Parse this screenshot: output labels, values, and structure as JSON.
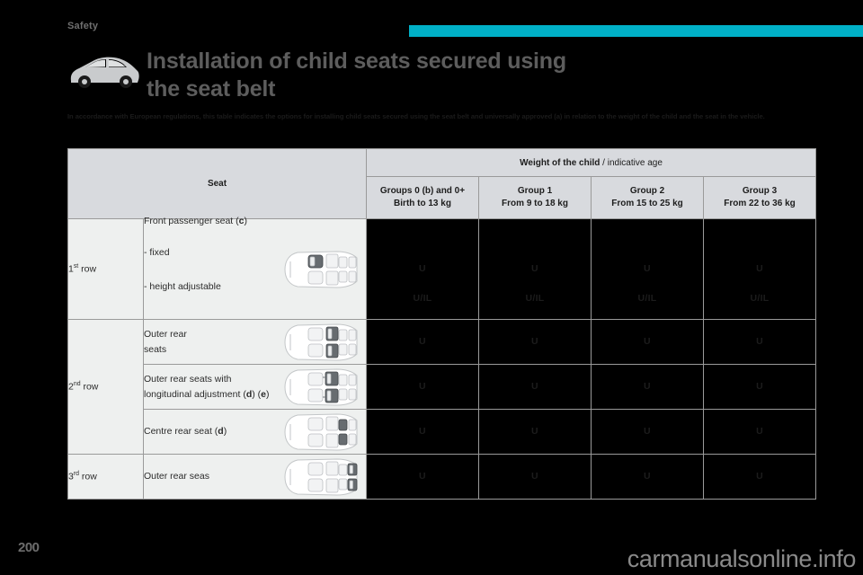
{
  "header": {
    "breadcrumb": "Safety",
    "accent_color": "#00b0c7"
  },
  "title": {
    "line1": "Installation of child seats secured using",
    "line2": "the seat belt",
    "icon": "car-side-view-icon"
  },
  "intro": {
    "line1": "In accordance with European regulations, this table indicates the options for installing child seats secured using the seat belt and universally approved (a)",
    "line2": "in relation to the weight of the child and the seat in the vehicle."
  },
  "table": {
    "seat_header": "Seat",
    "weight_header_bold": "Weight of the child",
    "weight_header_sep": " / ",
    "weight_header_light": "indicative age",
    "groups": [
      {
        "line1": "Groups 0 (b) and 0+",
        "line2": "Birth to 13 kg"
      },
      {
        "line1": "Group 1",
        "line2": "From 9 to 18 kg"
      },
      {
        "line1": "Group 2",
        "line2": "From 15 to 25 kg"
      },
      {
        "line1": "Group 3",
        "line2": "From 22 to 36 kg"
      }
    ],
    "rows": [
      {
        "row_label_num": "1",
        "row_label_sup": "st",
        "row_label_rest": " row",
        "seat_title": "Front passenger seat (",
        "seat_title_bold": "c",
        "seat_title_end": ")",
        "bullets": [
          "-     fixed",
          "-     height adjustable"
        ],
        "diagram": "seat-plan-front-passenger",
        "marks": [
          {
            "top": "U",
            "bottom": "U/IL"
          },
          {
            "top": "U",
            "bottom": "U/IL"
          },
          {
            "top": "U",
            "bottom": "U/IL"
          },
          {
            "top": "U",
            "bottom": "U/IL"
          }
        ]
      },
      {
        "row_label_num": "2",
        "row_label_sup": "nd",
        "row_label_rest": " row",
        "seat_line1": "Outer rear",
        "seat_line2": "seats",
        "diagram": "seat-plan-outer-rear-2nd",
        "marks": [
          {
            "top": "U"
          },
          {
            "top": "U"
          },
          {
            "top": "U"
          },
          {
            "top": "U"
          }
        ]
      },
      {
        "seat_line1": "Outer rear seats with",
        "seat_line2": "longitudinal adjustment (",
        "seat_bold1": "d",
        "seat_mid": ") (",
        "seat_bold2": "e",
        "seat_end": ")",
        "diagram": "seat-plan-outer-rear-adjustable",
        "marks": [
          {
            "top": "U"
          },
          {
            "top": "U"
          },
          {
            "top": "U"
          },
          {
            "top": "U"
          }
        ]
      },
      {
        "seat_line1": "Centre rear seat (",
        "seat_bold1": "d",
        "seat_end": ")",
        "diagram": "seat-plan-centre-rear",
        "marks": [
          {
            "top": "U"
          },
          {
            "top": "U"
          },
          {
            "top": "U"
          },
          {
            "top": "U"
          }
        ]
      },
      {
        "row_label_num": "3",
        "row_label_sup": "rd",
        "row_label_rest": " row",
        "seat_line1": "Outer rear seas",
        "diagram": "seat-plan-outer-rear-3rd",
        "marks": [
          {
            "top": "U"
          },
          {
            "top": "U"
          },
          {
            "top": "U"
          },
          {
            "top": "U"
          }
        ]
      }
    ]
  },
  "footer": {
    "page_number": "200",
    "watermark": "carmanualsonline.info"
  }
}
